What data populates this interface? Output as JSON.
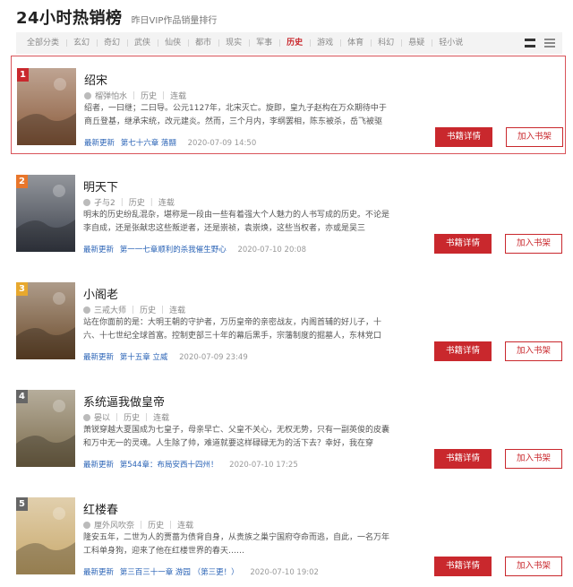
{
  "header": {
    "title": "24小时热销榜",
    "subtitle": "昨日VIP作品销量排行"
  },
  "categories": [
    {
      "label": "全部分类",
      "active": false
    },
    {
      "label": "玄幻",
      "active": false
    },
    {
      "label": "奇幻",
      "active": false
    },
    {
      "label": "武侠",
      "active": false
    },
    {
      "label": "仙侠",
      "active": false
    },
    {
      "label": "都市",
      "active": false
    },
    {
      "label": "现实",
      "active": false
    },
    {
      "label": "军事",
      "active": false
    },
    {
      "label": "历史",
      "active": true
    },
    {
      "label": "游戏",
      "active": false
    },
    {
      "label": "体育",
      "active": false
    },
    {
      "label": "科幻",
      "active": false
    },
    {
      "label": "悬疑",
      "active": false
    },
    {
      "label": "轻小说",
      "active": false
    }
  ],
  "buttons": {
    "detail": "书籍详情",
    "shelf": "加入书架"
  },
  "update_label": "最新更新",
  "books": [
    {
      "rank": "1",
      "title": "绍宋",
      "author": "榴弹怕水",
      "genre": "历史",
      "status": "连载",
      "desc": "绍者，一曰继；二曰导。公元1127年，北宋灭亡。旋即，皇九子赵构在万众期待中于商丘登基，继承宋统，改元建炎。然而，三个月内，李纲罢相，陈东被杀，岳飞被驱",
      "chapter": "第七十六章 落翮",
      "time": "2020-07-09 14:50",
      "cover_color": "#8a5a3a",
      "cover_text": "绍宋"
    },
    {
      "rank": "2",
      "title": "明天下",
      "author": "孑与2",
      "genre": "历史",
      "status": "连载",
      "desc": "明末的历史纷乱混杂，堪称是一段由一些有着强大个人魅力的人书写成的历史。不论是李自成，还是张献忠这些叛逆者，还是崇祯，袁崇焕，这些当权者，亦或是吴三",
      "chapter": "第一一七章顺利的杀我催生野心",
      "time": "2020-07-10 20:08",
      "cover_color": "#3a3f4a",
      "cover_text": "明天下"
    },
    {
      "rank": "3",
      "title": "小阁老",
      "author": "三戒大师",
      "genre": "历史",
      "status": "连载",
      "desc": "站在你面前的是：大明王朝的守护者，万历皇帝的亲密战友，内阁首辅的好儿子，十六、十七世纪全球首富。控制吏部三十年的幕后黑手，宗藩制度的掘墓人，东林党口",
      "chapter": "第十五章 立威",
      "time": "2020-07-09 23:49",
      "cover_color": "#6b4a2a",
      "cover_text": "小阁老"
    },
    {
      "rank": "4",
      "title": "系统逼我做皇帝",
      "author": "晏以",
      "genre": "历史",
      "status": "连载",
      "desc": "萧锐穿越大夏国成为七皇子，母亲早亡、父皇不关心，无权无势，只有一副英俊的皮囊和万中无一的灵魂。人生除了帅，难道就要这样碌碌无为的活下去？幸好，我在穿",
      "chapter": "第544章：布局安西十四州！",
      "time": "2020-07-10 17:25",
      "cover_color": "#7a6a4a",
      "cover_text": "系统逼我做皇帝"
    },
    {
      "rank": "5",
      "title": "红楼春",
      "author": "厘外风吹奈",
      "genre": "历史",
      "status": "连载",
      "desc": "隆安五年，二世为人的贾蔷为债背自身，从贵族之巢宁国府夺命而逃，自此，一名万年工科单身狗，迎来了他在红楼世界的春天……",
      "chapter": "第三百三十一章 游园 （第三更！）",
      "time": "2020-07-10 19:02",
      "cover_color": "#c8a86a",
      "cover_text": "红楼春"
    }
  ]
}
